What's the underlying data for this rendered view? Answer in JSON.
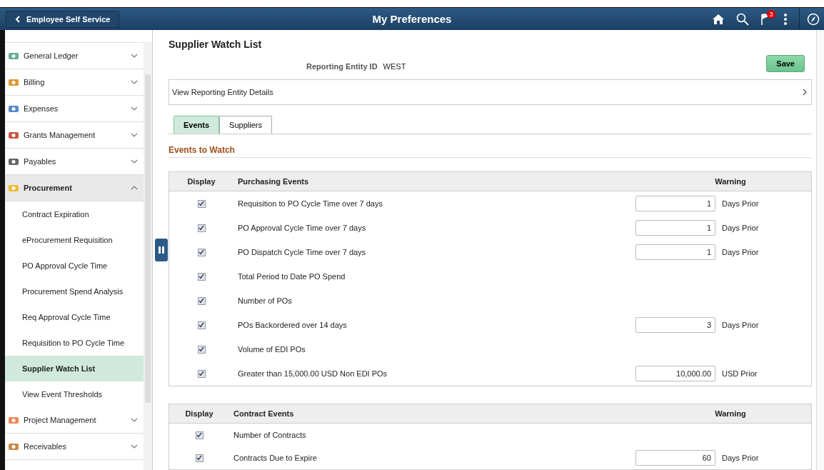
{
  "header": {
    "back_label": "Employee Self Service",
    "title": "My Preferences",
    "notification_count": "3"
  },
  "sidebar": {
    "items": [
      {
        "label": "General Ledger",
        "expanded": false
      },
      {
        "label": "Billing",
        "expanded": false
      },
      {
        "label": "Expenses",
        "expanded": false
      },
      {
        "label": "Grants Management",
        "expanded": false
      },
      {
        "label": "Payables",
        "expanded": false
      },
      {
        "label": "Procurement",
        "expanded": true,
        "children": [
          {
            "label": "Contract Expiration",
            "selected": false
          },
          {
            "label": "eProcurement Requisition",
            "selected": false
          },
          {
            "label": "PO Approval Cycle Time",
            "selected": false
          },
          {
            "label": "Procurement Spend Analysis",
            "selected": false
          },
          {
            "label": "Req Approval Cycle Time",
            "selected": false
          },
          {
            "label": "Requisition to PO Cycle Time",
            "selected": false
          },
          {
            "label": "Supplier Watch List",
            "selected": true
          },
          {
            "label": "View Event Thresholds",
            "selected": false
          }
        ]
      },
      {
        "label": "Project Management",
        "expanded": false
      },
      {
        "label": "Receivables",
        "expanded": false
      }
    ]
  },
  "page": {
    "title": "Supplier Watch List",
    "save_label": "Save",
    "entity_label": "Reporting Entity ID",
    "entity_value": "WEST",
    "details_link": "View Reporting Entity Details",
    "tabs": [
      {
        "label": "Events",
        "selected": true
      },
      {
        "label": "Suppliers",
        "selected": false
      }
    ],
    "section_title": "Events to Watch",
    "tables": [
      {
        "columns": [
          "Display",
          "Purchasing Events",
          "Warning"
        ],
        "rows": [
          {
            "checked": true,
            "label": "Requisition to PO Cycle Time over 7 days",
            "value": "1",
            "unit": "Days Prior"
          },
          {
            "checked": true,
            "label": "PO Approval Cycle Time over 7 days",
            "value": "1",
            "unit": "Days Prior"
          },
          {
            "checked": true,
            "label": "PO Dispatch Cycle Time over 7 days",
            "value": "1",
            "unit": "Days Prior"
          },
          {
            "checked": true,
            "label": "Total Period to Date PO Spend"
          },
          {
            "checked": true,
            "label": "Number of POs"
          },
          {
            "checked": true,
            "label": "POs Backordered over 14 days",
            "value": "3",
            "unit": "Days Prior"
          },
          {
            "checked": true,
            "label": "Volume of EDI POs"
          },
          {
            "checked": true,
            "label": "Greater than 15,000.00 USD Non EDI POs",
            "value": "10,000.00",
            "unit": "USD Prior"
          }
        ]
      },
      {
        "columns": [
          "Display",
          "Contract Events",
          "Warning"
        ],
        "rows": [
          {
            "checked": true,
            "label": "Number of Contracts"
          },
          {
            "checked": true,
            "label": "Contracts Due to Expire",
            "value": "60",
            "unit": "Days Prior"
          }
        ]
      }
    ]
  }
}
